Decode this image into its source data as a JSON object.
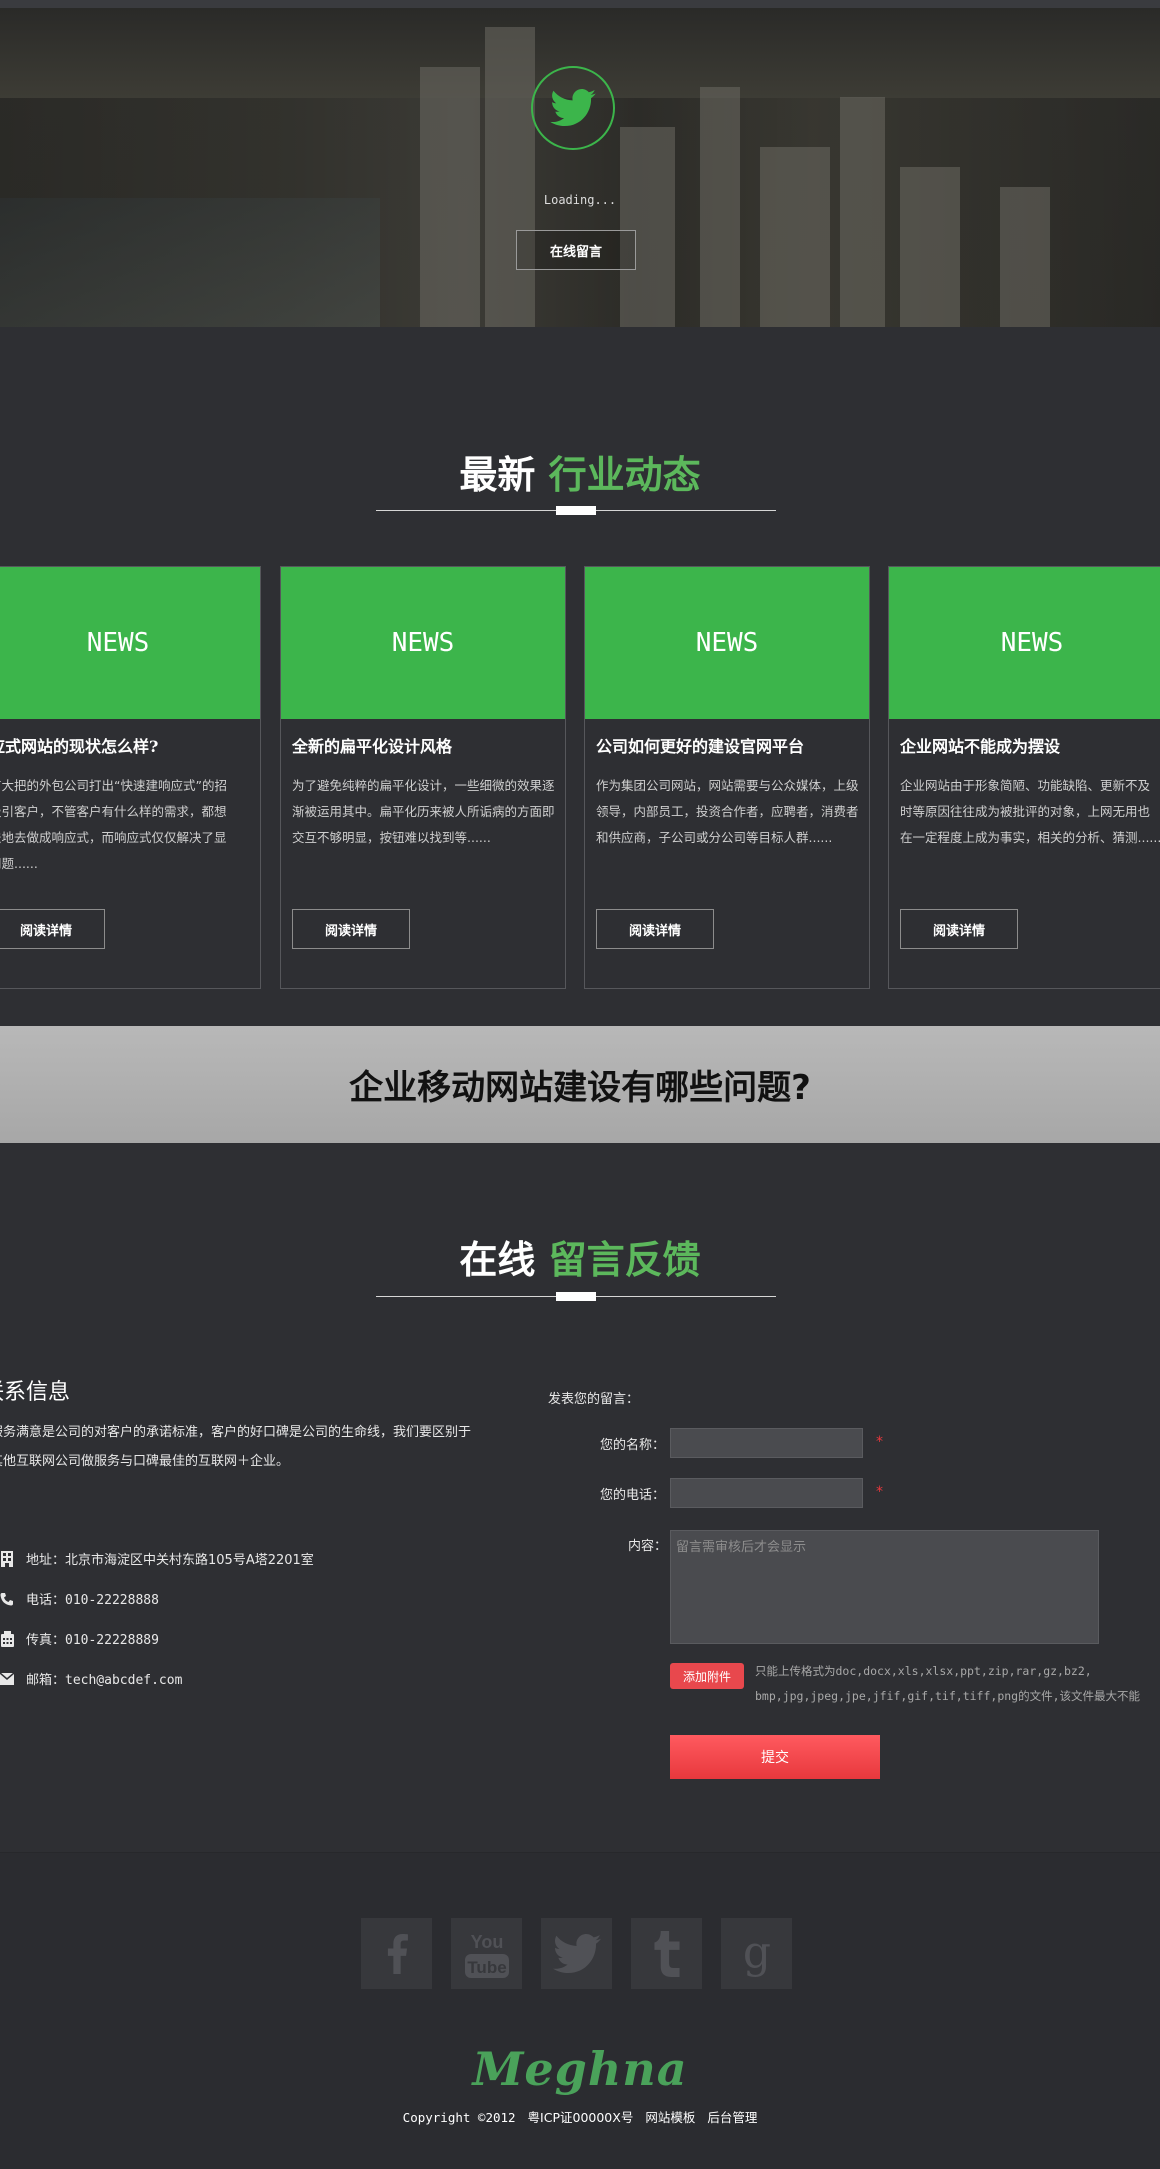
{
  "hero": {
    "loading_text": "Loading...",
    "button_label": "在线留言"
  },
  "news_section": {
    "title_main": "最新",
    "title_accent": "行业动态",
    "cards": [
      {
        "badge": "NEWS",
        "title": "响应式网站的现状怎么样?",
        "desc": "国内有大把的外包公司打出“快速建响应式”的招牌来吸引客户，不管客户有什么样的需求，都想方设法地去做成响应式，而响应式仅仅解决了显示的问题......",
        "button": "阅读详情"
      },
      {
        "badge": "NEWS",
        "title": "全新的扁平化设计风格",
        "desc": "为了避免纯粹的扁平化设计，一些细微的效果逐渐被运用其中。扁平化历来被人所诟病的方面即交互不够明显，按钮难以找到等......",
        "button": "阅读详情"
      },
      {
        "badge": "NEWS",
        "title": "公司如何更好的建设官网平台",
        "desc": "作为集团公司网站，网站需要与公众媒体，上级领导，内部员工，投资合作者，应聘者，消费者和供应商，子公司或分公司等目标人群......",
        "button": "阅读详情"
      },
      {
        "badge": "NEWS",
        "title": "企业网站不能成为摆设",
        "desc": "企业网站由于形象简陋、功能缺陷、更新不及时等原因往往成为被批评的对象，上网无用也在一定程度上成为事实，相关的分析、猜测......",
        "button": "阅读详情"
      }
    ]
  },
  "banner": {
    "text": "企业移动网站建设有哪些问题?"
  },
  "feedback_section": {
    "title_main": "在线",
    "title_accent": "留言反馈"
  },
  "contact": {
    "title": "联系信息",
    "desc": "服务满意是公司的对客户的承诺标准，客户的好口碑是公司的生命线，我们要区别于其他互联网公司做服务与口碑最佳的互联网＋企业。",
    "address": "地址：北京市海淀区中关村东路105号A塔2201室",
    "phone": "电话：010-22228888",
    "fax": "传真：010-22228889",
    "email": "邮箱：tech@abcdef.com"
  },
  "form": {
    "heading": "发表您的留言：",
    "name_label": "您的名称：",
    "phone_label": "您的电话：",
    "content_label": "内容：",
    "required_mark": "*",
    "content_placeholder": "留言需审核后才会显示",
    "attach_button": "添加附件",
    "attach_note_line1": "只能上传格式为doc,docx,xls,xlsx,ppt,zip,rar,gz,bz2,",
    "attach_note_line2": "bmp,jpg,jpeg,jpe,jfif,gif,tif,tiff,png的文件,该文件最大不能",
    "submit_button": "提交"
  },
  "footer": {
    "social": [
      "facebook-icon",
      "youtube-icon",
      "twitter-icon",
      "tumblr-icon",
      "google-icon"
    ],
    "logo_text": "Meghna",
    "copyright": "Copyright ©2012",
    "icp": "粤ICP证00000X号",
    "link_template": "网站模板",
    "link_admin": "后台管理"
  },
  "colors": {
    "accent_green": "#3cb54b",
    "title_green": "#5cb85c",
    "submit_red": "#e8383d",
    "background": "#2e2f33"
  }
}
